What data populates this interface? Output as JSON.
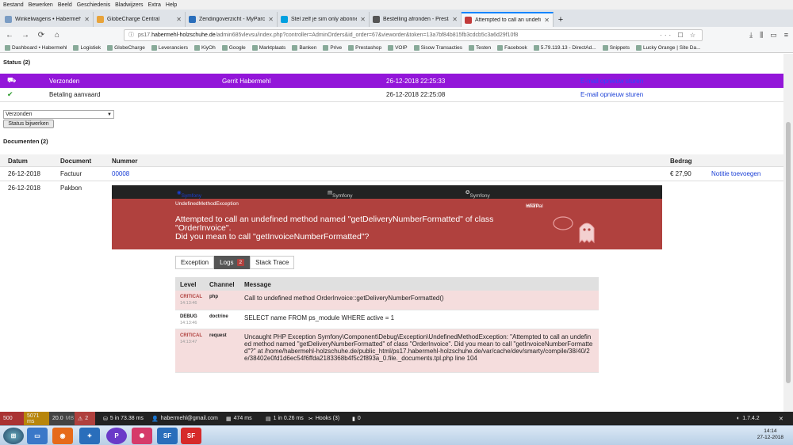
{
  "menu": [
    "Bestand",
    "Bewerken",
    "Beeld",
    "Geschiedenis",
    "Bladwijzers",
    "Extra",
    "Help"
  ],
  "tabs": [
    {
      "title": "Winkelwagens • Habermehl.nl",
      "color": "#7a9cc4"
    },
    {
      "title": "GlobeCharge Central",
      "color": "#e8a33a"
    },
    {
      "title": "Zendingoverzicht - MyParcel",
      "color": "#2a6ebb"
    },
    {
      "title": "Stel zelf je sim only abonneme",
      "color": "#00a0e0"
    },
    {
      "title": "Bestelling afronden - PrestaSh",
      "color": "#555"
    },
    {
      "title": "Attempted to call an undefinec",
      "color": "#c23a3a"
    }
  ],
  "url": {
    "prefix": "ps17.",
    "domain": "habermehl-holzschuhe.de",
    "path": "/admin685vlevsu/index.php?controller=AdminOrders&id_order=67&vieworder&token=13a7bf84b815fb3cdcb5c3a6d29f10f8"
  },
  "bookmarks": [
    "Dashboard • Habermehl",
    "Logistiek",
    "GlobeCharge",
    "Leveranciers",
    "KiyOh",
    "Google",
    "Marktplaats",
    "Banken",
    "Prive",
    "Prestashop",
    "VOIP",
    "Sisow Transacties",
    "Testen",
    "Facebook",
    "5.79.119.13 - DirectAd...",
    "Snippets",
    "Lucky Orange | Site Da..."
  ],
  "status": {
    "title": "Status (2)",
    "rows": [
      {
        "icon": "truck-icon",
        "label": "Verzonden",
        "employee": "Gerrit Habermehl",
        "date": "26-12-2018 22:25:33",
        "action": "E-mail opnieuw sturen"
      },
      {
        "icon": "check-icon",
        "label": "Betaling aanvaard",
        "employee": "",
        "date": "26-12-2018 22:25:08",
        "action": "E-mail opnieuw sturen"
      }
    ],
    "select_value": "Verzonden",
    "update_button": "Status bijwerken"
  },
  "documents": {
    "title": "Documenten (2)",
    "headers": {
      "date": "Datum",
      "document": "Document",
      "number": "Nummer",
      "amount": "Bedrag"
    },
    "rows": [
      {
        "date": "26-12-2018",
        "document": "Factuur",
        "number": "00008",
        "amount": "€ 27,90",
        "action": "Notitie toevoegen"
      },
      {
        "date": "26-12-2018",
        "document": "Pakbon"
      }
    ]
  },
  "symfony": {
    "home": "Symfony Home",
    "docs": "Symfony Docs",
    "support": "Symfony Support",
    "exception_class": "UndefinedMethodException",
    "http_code": "HTTP 500",
    "http_text": "Internal Server Error",
    "message": "Attempted to call an undefined method named \"getDeliveryNumberFormatted\" of class \"OrderInvoice\".\nDid you mean to call \"getInvoiceNumberFormatted\"?",
    "tabs": {
      "exception": "Exception",
      "logs": "Logs",
      "logs_count": "2",
      "trace": "Stack Trace"
    },
    "log_headers": {
      "level": "Level",
      "channel": "Channel",
      "message": "Message"
    },
    "logs": [
      {
        "level": "CRITICAL",
        "time": "14:13:46",
        "channel": "php",
        "message": "Call to undefined method OrderInvoice::getDeliveryNumberFormatted()",
        "critical": true
      },
      {
        "level": "DEBUG",
        "time": "14:13:46",
        "channel": "doctrine",
        "message": "SELECT name FROM ps_module WHERE active = 1",
        "critical": false
      },
      {
        "level": "CRITICAL",
        "time": "14:13:47",
        "channel": "request",
        "message": "Uncaught PHP Exception Symfony\\Component\\Debug\\Exception\\UndefinedMethodException: \"Attempted to call an undefined method named \"getDeliveryNumberFormatted\" of class \"OrderInvoice\". Did you mean to call \"getInvoiceNumberFormatted\"?\" at /home/habermehl-holzschuhe.de/public_html/ps17.habermehl-holzschuhe.de/var/cache/dev/smarty/compile/38/40/2e/38402e0fd1d6ec54f6ffda2183368b4f5c2f893a_0.file._documents.tpl.php line 104",
        "critical": true
      }
    ]
  },
  "debugbar": {
    "status": "500",
    "time": "5071 ms",
    "memory": "20.0",
    "memory_unit": "MB",
    "errors": "2",
    "db": "5 in 73.38 ms",
    "user": "habermehl@gmail.com",
    "render": "474 ms",
    "cache": "1 in 0.26 ms",
    "hooks": "Hooks (3)",
    "modules": "0",
    "version": "1.7.4.2"
  },
  "clock": {
    "time": "14:14",
    "date": "27-12-2018"
  },
  "colors": {
    "purple": "#9316d9",
    "sf_red": "#b0413e",
    "link": "#1a3fd6"
  }
}
